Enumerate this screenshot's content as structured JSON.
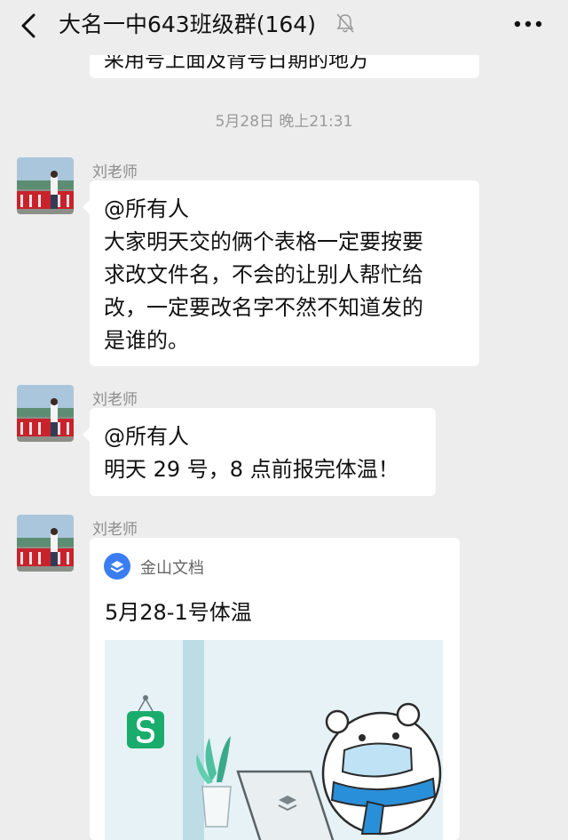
{
  "header": {
    "title": "大名一中643班级群(164)",
    "back_icon": "chevron-left-icon",
    "mute_icon": "bell-muted-icon",
    "more_icon": "more-dots-icon"
  },
  "previous_message": {
    "partial_text": "采用号上面及背号日期的地方"
  },
  "timestamp": "5月28日 晚上21:31",
  "messages": [
    {
      "sender": "刘老师",
      "lines": [
        "@所有人",
        "大家明天交的俩个表格一定要按要",
        "求改文件名，不会的让别人帮忙给",
        "改，一定要改名字不然不知道发的",
        "是谁的。"
      ]
    },
    {
      "sender": "刘老师",
      "lines": [
        "@所有人",
        "明天 29 号，8 点前报完体温！"
      ]
    },
    {
      "sender": "刘老师",
      "card": {
        "app_name": "金山文档",
        "title": "5月28-1号体温",
        "logo_icon": "kingsoft-docs-icon",
        "preview": "document-preview-image"
      }
    }
  ],
  "colors": {
    "background": "#ededed",
    "bubble": "#ffffff",
    "sheet_green": "#1aac6c",
    "docs_blue": "#3a7df2"
  }
}
